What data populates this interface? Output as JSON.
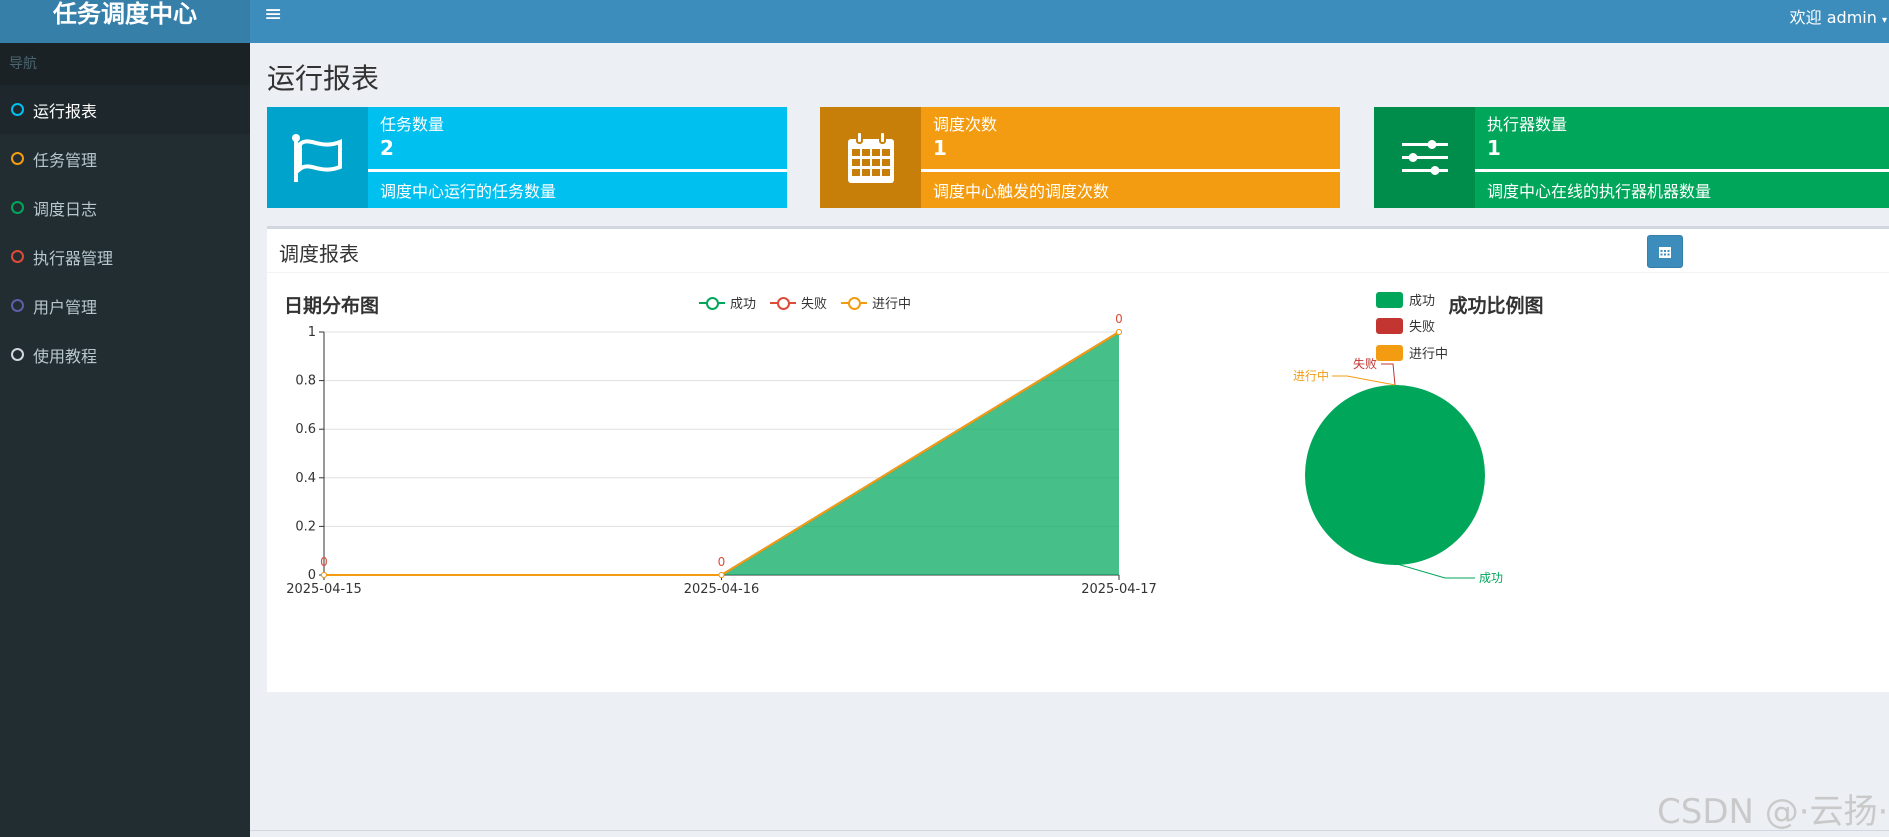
{
  "app": {
    "title": "任务调度中心"
  },
  "topbar": {
    "welcome": "欢迎 admin"
  },
  "sidebar": {
    "header": "导航",
    "items": [
      {
        "label": "运行报表",
        "color": "#00c0ef",
        "active": true
      },
      {
        "label": "任务管理",
        "color": "#f39c12"
      },
      {
        "label": "调度日志",
        "color": "#00a65a"
      },
      {
        "label": "执行器管理",
        "color": "#dd4b39"
      },
      {
        "label": "用户管理",
        "color": "#605ca8"
      },
      {
        "label": "使用教程",
        "color": "#d2d6de"
      }
    ]
  },
  "page": {
    "title": "运行报表"
  },
  "info_boxes": [
    {
      "label": "任务数量",
      "number": "2",
      "desc": "调度中心运行的任务数量",
      "icon": "flag-icon",
      "bg": "#00c0ef",
      "icon_bg": "#00a3cb"
    },
    {
      "label": "调度次数",
      "number": "1",
      "desc": "调度中心触发的调度次数",
      "icon": "calendar-icon",
      "bg": "#f39c12",
      "icon_bg": "#c87f0a"
    },
    {
      "label": "执行器数量",
      "number": "1",
      "desc": "调度中心在线的执行器机器数量",
      "icon": "sliders-icon",
      "bg": "#00a65a",
      "icon_bg": "#008d4c"
    }
  ],
  "report": {
    "title": "调度报表"
  },
  "chart_data": [
    {
      "type": "area",
      "title": "日期分布图",
      "x": [
        "2025-04-15",
        "2025-04-16",
        "2025-04-17"
      ],
      "series": [
        {
          "name": "成功",
          "values": [
            0,
            0,
            1
          ],
          "color": "#00a65a"
        },
        {
          "name": "失败",
          "values": [
            0,
            0,
            0
          ],
          "color": "#dd4b39"
        },
        {
          "name": "进行中",
          "values": [
            0,
            0,
            0
          ],
          "color": "#f39c12"
        }
      ],
      "point_labels": [
        "0",
        "0",
        "0"
      ],
      "yticks": [
        "0",
        "0.2",
        "0.4",
        "0.6",
        "0.8",
        "1"
      ],
      "ylim": [
        0,
        1
      ],
      "legend_position": "top-center",
      "grid": true
    },
    {
      "type": "pie",
      "title": "成功比例图",
      "slices": [
        {
          "name": "成功",
          "value": 1,
          "color": "#00a65a"
        },
        {
          "name": "失败",
          "value": 0,
          "color": "#c23531"
        },
        {
          "name": "进行中",
          "value": 0,
          "color": "#f39c12"
        }
      ],
      "legend_position": "top-left"
    }
  ],
  "watermark": "CSDN @·云扬·"
}
